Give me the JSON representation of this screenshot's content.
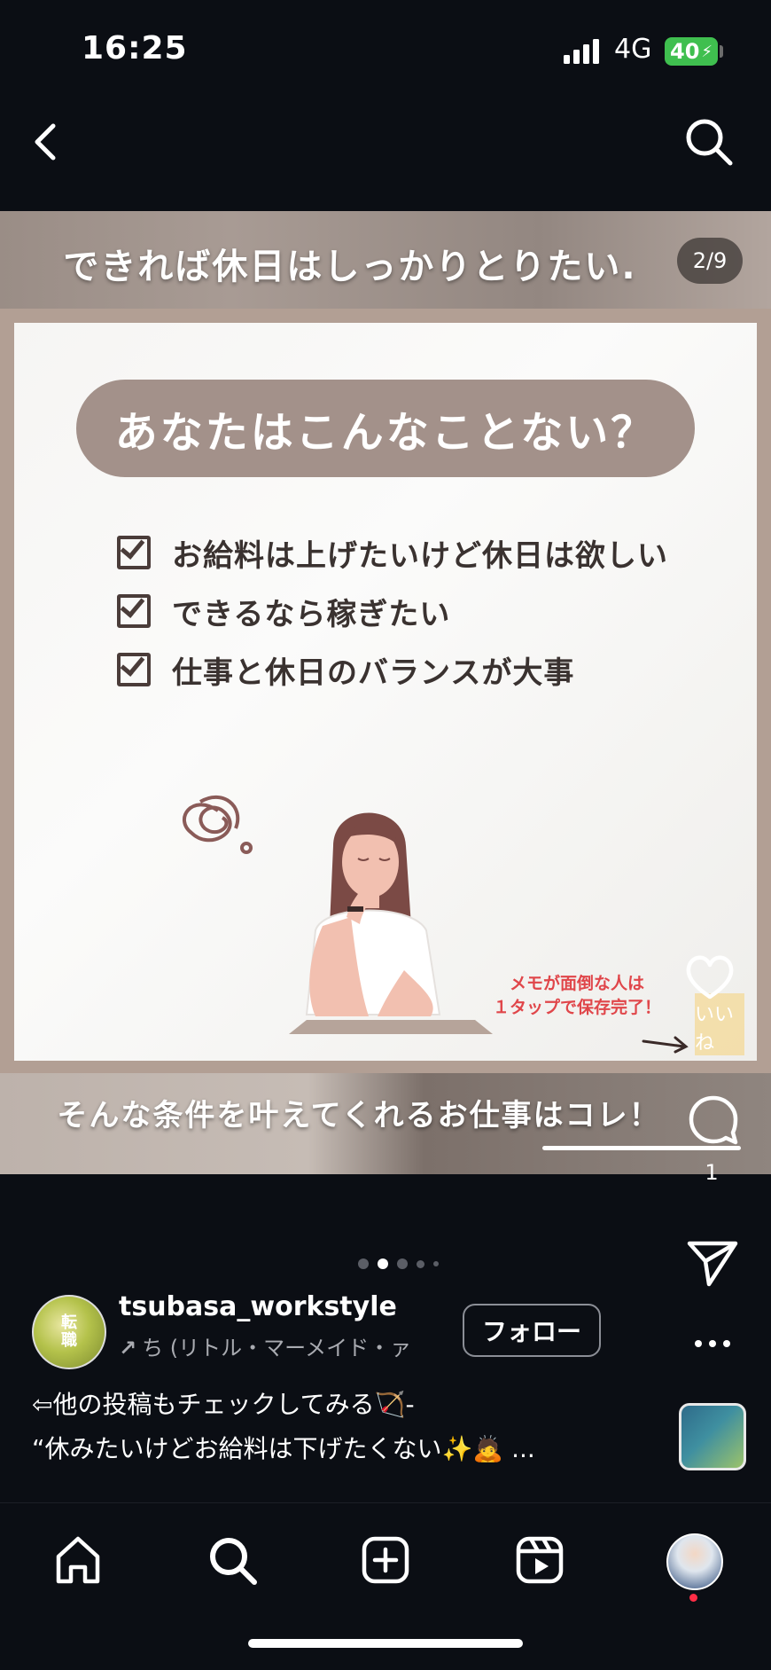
{
  "status_bar": {
    "time": "16:25",
    "network": "4G",
    "battery": "40"
  },
  "post": {
    "page_counter": "2/9",
    "slide": {
      "top_caption": "できれば休日はしっかりとりたい.",
      "headline": "あなたはこんなことない？",
      "checklist": [
        "お給料は上げたいけど休日は欲しい",
        "できるなら稼ぎたい",
        "仕事と休日のバランスが大事"
      ],
      "save_note_line1": "メモが面倒な人は",
      "save_note_line2": "１タップで保存完了！",
      "like_overlay": "いいね",
      "bottom_caption": "そんな条件を叶えてくれるお仕事はコレ！"
    },
    "comment_count": "1",
    "carousel": {
      "total": 5,
      "active": 1
    },
    "author": {
      "avatar_text_1": "転",
      "avatar_text_2": "職",
      "username": "tsubasa_workstyle",
      "music": "ち (リトル・マーメイド・ァ",
      "follow_label": "フォロー"
    },
    "caption_line1": "⇦他の投稿もチェックしてみる🏹-",
    "caption_line2": "“休みたいけどお給料は下げたくない✨🙇 ..."
  },
  "colors": {
    "accent_pill": "#a3918a",
    "frame": "#b29f94",
    "battery": "#3fbf4f",
    "save_note": "#e0464a"
  },
  "icons": {
    "back": "chevron-left-icon",
    "search": "search-icon",
    "like": "heart-icon",
    "comment": "comment-icon",
    "share": "send-icon",
    "more": "more-icon",
    "home": "home-icon",
    "explore": "search-icon",
    "create": "plus-square-icon",
    "reels": "reels-icon",
    "profile": "profile-avatar"
  }
}
